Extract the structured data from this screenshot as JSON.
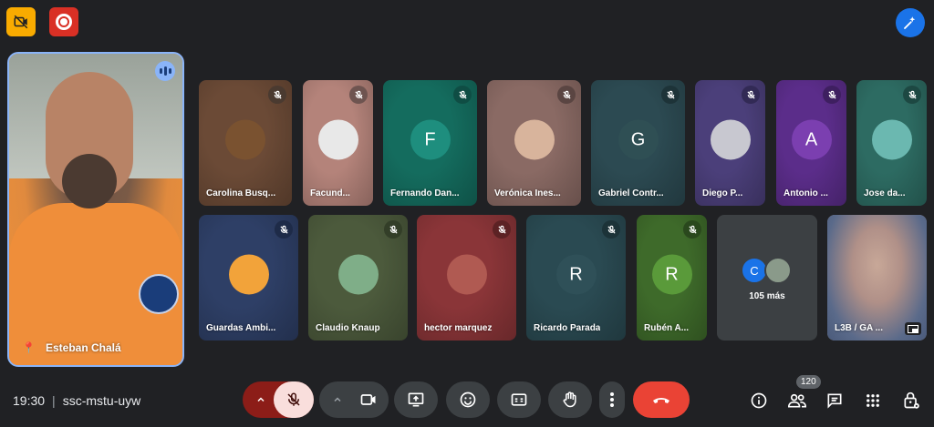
{
  "meeting": {
    "time": "19:30",
    "separator": "|",
    "code": "ssc-mstu-uyw",
    "participants_count": "120"
  },
  "speaker": {
    "name": "Esteban Chalá"
  },
  "tiles": [
    {
      "name": "Carolina Busq...",
      "initial": "",
      "avatar_color": "#7a5230",
      "bg": "#6b4a36",
      "mic_color": "#4a3a30"
    },
    {
      "name": "Facund...",
      "initial": "",
      "avatar_color": "#e8e8e8",
      "bg": "#b4837a",
      "mic_color": "#6e5450"
    },
    {
      "name": "Fernando Dan...",
      "initial": "F",
      "avatar_color": "#1e8e7e",
      "bg": "#146c5e",
      "mic_color": "#0f4d44"
    },
    {
      "name": "Verónica Ines...",
      "initial": "",
      "avatar_color": "#d8b49c",
      "bg": "#8a6a64",
      "mic_color": "#5a4542"
    },
    {
      "name": "Gabriel Contr...",
      "initial": "G",
      "avatar_color": "#2f4f54",
      "bg": "#2c4a52",
      "mic_color": "#1d3338"
    },
    {
      "name": "Diego P...",
      "initial": "",
      "avatar_color": "#c8c8d0",
      "bg": "#4b3f7a",
      "mic_color": "#322a55"
    },
    {
      "name": "Antonio ...",
      "initial": "A",
      "avatar_color": "#7b3fb0",
      "bg": "#5b2d8a",
      "mic_color": "#3e1f60"
    },
    {
      "name": "Jose da...",
      "initial": "",
      "avatar_color": "#6bb8b0",
      "bg": "#2d6b62",
      "mic_color": "#1d4842"
    },
    {
      "name": "Guardas Ambi...",
      "initial": "",
      "avatar_color": "#f2a33a",
      "bg": "#2e3f66",
      "mic_color": "#1e2b48"
    },
    {
      "name": "Claudio Knaup",
      "initial": "",
      "avatar_color": "#7fae88",
      "bg": "#4c5a3c",
      "mic_color": "#333e28"
    },
    {
      "name": "hector marquez",
      "initial": "",
      "avatar_color": "#b05a52",
      "bg": "#8a3538",
      "mic_color": "#5c2224"
    },
    {
      "name": "Ricardo Parada",
      "initial": "R",
      "avatar_color": "#2f5058",
      "bg": "#2a4a52",
      "mic_color": "#1c3338"
    },
    {
      "name": "Rubén A...",
      "initial": "R",
      "avatar_color": "#5a9a3a",
      "bg": "#3e6a2a",
      "mic_color": "#2a481d"
    },
    {
      "name": "L3B / GA ...",
      "initial": "",
      "avatar_color": "#b8a8a0",
      "bg": "#9a8a86",
      "mic_color": "#5f5553"
    }
  ],
  "more_tile": {
    "initial": "C",
    "label": "105 más",
    "circle_color": "#1a73e8"
  },
  "icons": {
    "top_left_1": "no-camera-icon",
    "top_left_2": "record-icon",
    "top_right": "companion-sparkle-icon",
    "controls": [
      "chevron-up-icon",
      "mic-off-icon",
      "chevron-up-icon",
      "camera-icon",
      "present-screen-icon",
      "emoji-icon",
      "captions-icon",
      "raise-hand-icon",
      "more-vert-icon",
      "end-call-icon"
    ],
    "right": [
      "info-icon",
      "people-icon",
      "chat-icon",
      "activities-icon",
      "host-controls-icon"
    ]
  }
}
